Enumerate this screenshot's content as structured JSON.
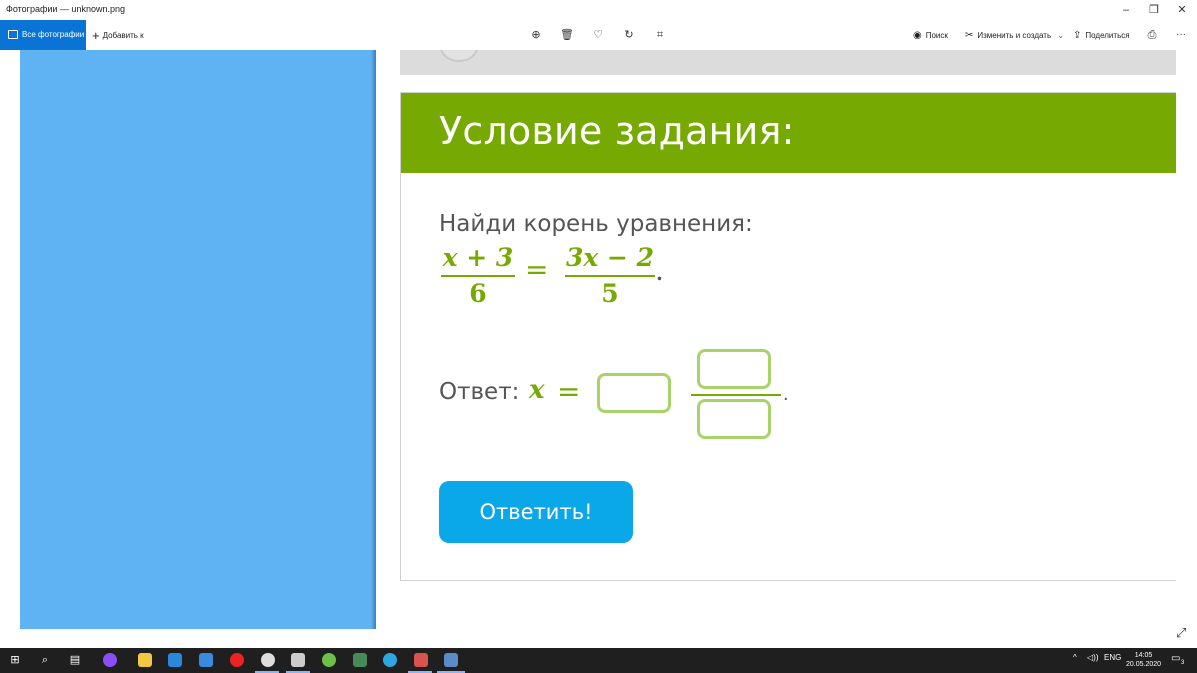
{
  "window": {
    "title": "Фотографии — unknown.png",
    "minimize": "–",
    "restore": "❐",
    "close": "✕"
  },
  "toolbar": {
    "all_photos": "Все фотографии",
    "add_to": "Добавить к",
    "search": "Поиск",
    "edit_create": "Изменить и создать",
    "share": "Поделиться",
    "more": "···",
    "icons": [
      "zoom-icon",
      "delete-icon",
      "favorite-icon",
      "rotate-icon",
      "crop-icon",
      "print-icon"
    ]
  },
  "task_page": {
    "header": "Условие задания:",
    "prompt": "Найди корень уравнения:",
    "equation": {
      "left_num": "x + 3",
      "left_den": "6",
      "equals": "=",
      "right_num": "3x − 2",
      "right_den": "5",
      "end_dot": "."
    },
    "answer_label": "Ответ:",
    "answer_var": "x",
    "answer_equals": "=",
    "answer_end": ".",
    "submit_button": "Ответить!"
  },
  "colors": {
    "accent_green": "#76aa02",
    "button_blue": "#0aa8e8",
    "side_blue": "#5fb3f3",
    "toolbar_blue": "#0a74d6"
  },
  "taskbar": {
    "language": "ENG",
    "time": "14:05",
    "date": "20.05.2020",
    "notifications": "3"
  }
}
